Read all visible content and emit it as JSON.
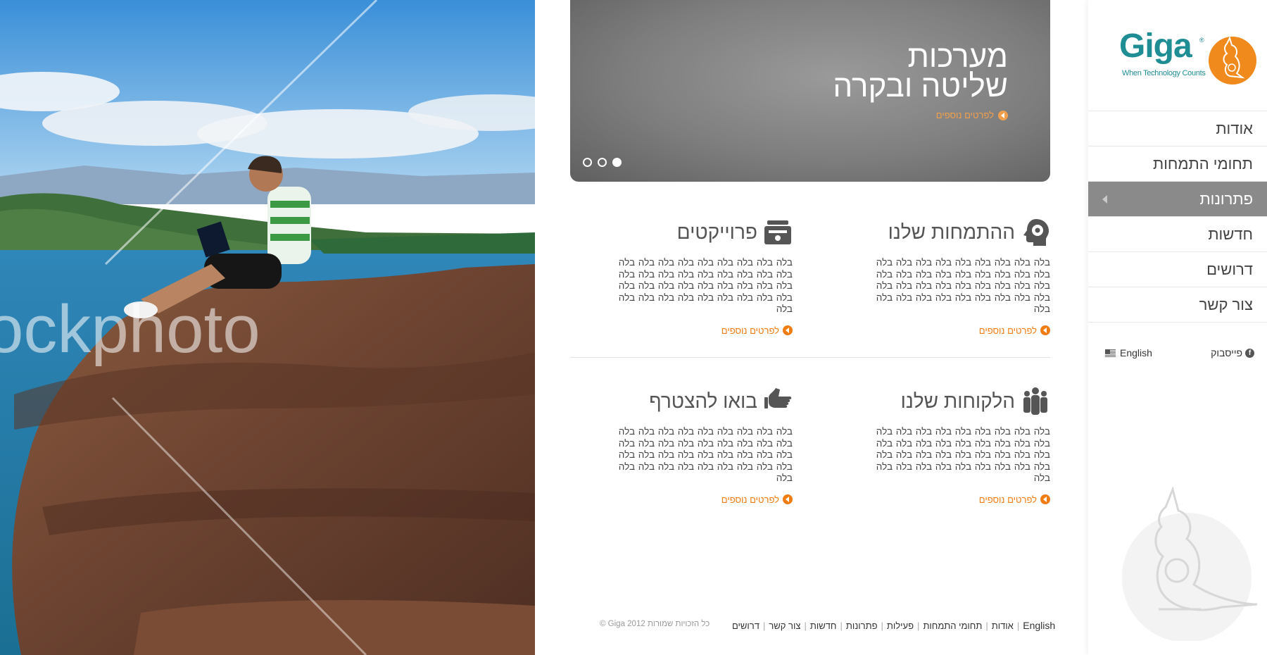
{
  "hero": {
    "watermark_text": "ockphoto"
  },
  "logo": {
    "name": "Giga",
    "tagline": "When Technology Counts",
    "reg": "®"
  },
  "nav": {
    "items": [
      {
        "label": "אודות"
      },
      {
        "label": "תחומי התמחות"
      },
      {
        "label": "פתרונות"
      },
      {
        "label": "חדשות"
      },
      {
        "label": "דרושים"
      },
      {
        "label": "צור קשר"
      }
    ],
    "active_index": 2
  },
  "sidebar_links": {
    "facebook": "פייסבוק",
    "english": "English"
  },
  "slider": {
    "title_line1": "מערכות",
    "title_line2": "שליטה ובקרה",
    "more": "לפרטים נוספים",
    "slide_count": 3,
    "active_slide": 0
  },
  "features": [
    {
      "title": "ההתמחות שלנו",
      "icon": "head-gear-icon",
      "text": "בלה בלה בלה בלה בלה בלה בלה בלה בלה בלה בלה בלה בלה בלה בלה בלה בלה בלה בלה בלה בלה בלה בלה בלה בלה בלה בלה בלה בלה בלה בלה בלה בלה בלה בלה בלה בלה",
      "more": "לפרטים נוספים"
    },
    {
      "title": "פרוייקטים",
      "icon": "briefcase-icon",
      "text": "בלה בלה בלה בלה בלה בלה בלה בלה בלה בלה בלה בלה בלה בלה בלה בלה בלה בלה בלה בלה בלה בלה בלה בלה בלה בלה בלה בלה בלה בלה בלה בלה בלה בלה בלה בלה בלה",
      "more": "לפרטים נוספים"
    },
    {
      "title": "הלקוחות שלנו",
      "icon": "people-icon",
      "text": "בלה בלה בלה בלה בלה בלה בלה בלה בלה בלה בלה בלה בלה בלה בלה בלה בלה בלה בלה בלה בלה בלה בלה בלה בלה בלה בלה בלה בלה בלה בלה בלה בלה בלה בלה בלה בלה",
      "more": "לפרטים נוספים"
    },
    {
      "title": "בואו להצטרף",
      "icon": "thumbs-up-icon",
      "text": "בלה בלה בלה בלה בלה בלה בלה בלה בלה בלה בלה בלה בלה בלה בלה בלה בלה בלה בלה בלה בלה בלה בלה בלה בלה בלה בלה בלה בלה בלה בלה בלה בלה בלה בלה בלה בלה",
      "more": "לפרטים נוספים"
    }
  ],
  "footer": {
    "links": [
      "English",
      "אודות",
      "תחומי התמחות",
      "פעילות",
      "פתרונות",
      "חדשות",
      "צור קשר",
      "דרושים"
    ],
    "copyright": "כל הזכויות שמורות Giga 2012 ©"
  },
  "colors": {
    "accent": "#f07c12",
    "brand_teal": "#1f8d94",
    "active_nav": "#8a8a8a"
  }
}
